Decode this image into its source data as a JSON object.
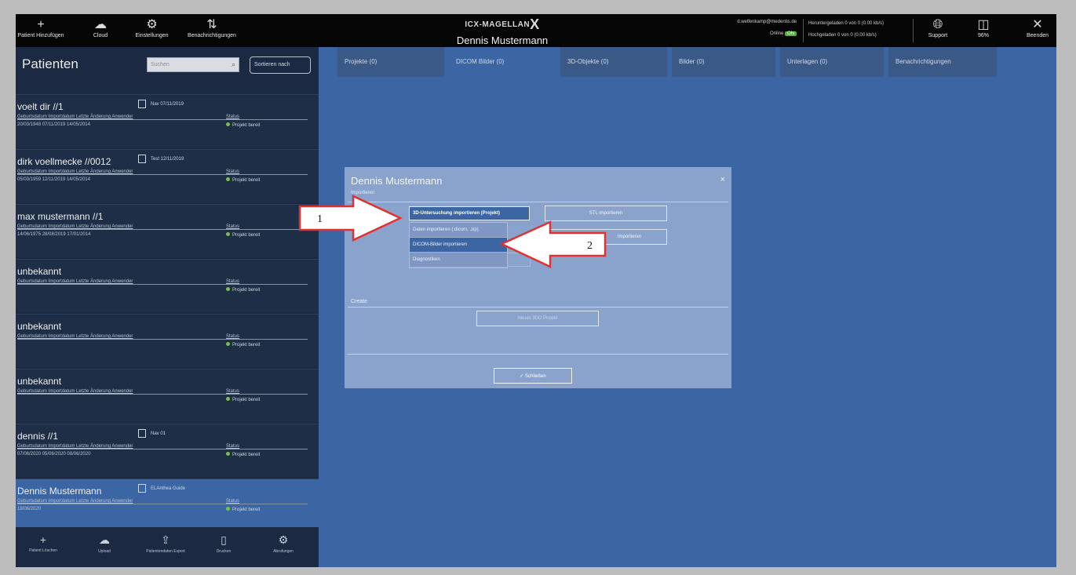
{
  "topbar": {
    "buttons": [
      {
        "label": "Patient Hinzufügen",
        "icon": "plus-icon"
      },
      {
        "label": "Cloud",
        "icon": "cloud-icon"
      },
      {
        "label": "Einstellungen",
        "icon": "gear-icon"
      },
      {
        "label": "Benachrichtigungen",
        "icon": "sort-icon"
      }
    ],
    "brand": "ICX-MAGELLAN",
    "brand_mark": "X",
    "patient_name": "Dennis Mustermann",
    "user_email": "d.welfenkamp@medentis.de",
    "online_label": "Online",
    "online_badge": "ON",
    "upload_status": "Heruntergeladen 0 von 0 (0.00 kb/s)",
    "download_status": "Hochgeladen 0 von 0 (0.00 kb/s)",
    "right_buttons": [
      {
        "label": "Support",
        "icon": "globe-icon"
      },
      {
        "label": "96%",
        "icon": "layout-icon"
      },
      {
        "label": "Beenden",
        "icon": "close-icon"
      }
    ]
  },
  "sidebar": {
    "title": "Patienten",
    "search_placeholder": "Suchen",
    "filter_label": "Sortieren nach",
    "columns_label": "Geburtsdatum  Importdatum   Letzte Änderung  Anwender",
    "status_label": "Status",
    "patients": [
      {
        "name": "voelt dir //1",
        "doc": "Nav 07/11/2019",
        "values": "20/03/1948   07/11/2019   14/05/2014",
        "status": "Projekt bereit"
      },
      {
        "name": "dirk voellmecke //0012",
        "doc": "Test 12/11/2019",
        "values": "05/03/1959   12/11/2019   14/05/2014",
        "status": "Projekt bereit"
      },
      {
        "name": "max mustermann //1",
        "doc": "",
        "values": "14/06/1975   28/08/2019   17/01/2014",
        "status": "Projekt bereit"
      },
      {
        "name": "unbekannt",
        "doc": "",
        "values": "",
        "status": "Projekt bereit"
      },
      {
        "name": "unbekannt",
        "doc": "",
        "values": "",
        "status": "Projekt bereit"
      },
      {
        "name": "unbekannt",
        "doc": "",
        "values": "",
        "status": "Projekt bereit"
      },
      {
        "name": "dennis //1",
        "doc": "Nav 01",
        "values": "07/06/2020   05/06/2020   08/06/2020",
        "status": "Projekt bereit"
      },
      {
        "name": "Dennis Mustermann",
        "doc": "ELAnthea Guide",
        "values": "18/06/2020",
        "status": "Projekt bereit"
      }
    ],
    "footer": [
      {
        "label": "Patient Löschen",
        "icon": "plus-icon"
      },
      {
        "label": "Upload",
        "icon": "cloud-icon"
      },
      {
        "label": "Patientendaten Export",
        "icon": "upload-icon"
      },
      {
        "label": "Drucken",
        "icon": "print-icon"
      },
      {
        "label": "Abrufungen",
        "icon": "gear-icon"
      }
    ]
  },
  "tabs": [
    {
      "label": "Projekte (0)"
    },
    {
      "label": "DICOM Bilder (0)"
    },
    {
      "label": "3D-Objekte (0)"
    },
    {
      "label": "Bilder (0)"
    },
    {
      "label": "Unterlagen (0)"
    },
    {
      "label": "Benachrichtigungen"
    }
  ],
  "dialog": {
    "title": "Dennis Mustermann",
    "subtitle": "Importieren",
    "combo_value": "3D-Untersuchung importieren (Projekt)",
    "dropdown": [
      "Daten importieren (.dicom, .zip)",
      "DICOM-Bilder importieren",
      "Diagnostiken"
    ],
    "btn_stl": "STL importieren",
    "btn_import": "Importieren",
    "section_create": "Create",
    "btn_new_project": "Neues 3DD Projekt",
    "btn_close": "Schließen",
    "close_glyph": "×"
  },
  "callouts": {
    "one": "1",
    "two": "2"
  },
  "colors": {
    "accent": "#3b66a3",
    "topbar": "#060606",
    "sidebar": "#1b2a42",
    "status_ok": "#7ac04a"
  }
}
